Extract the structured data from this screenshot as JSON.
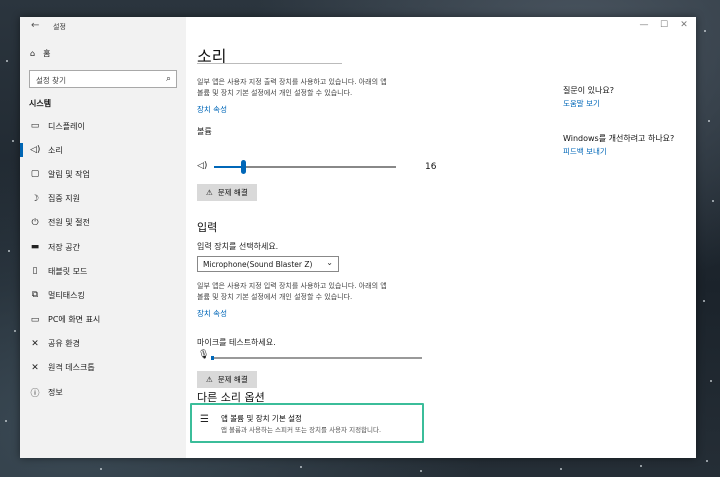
{
  "window": {
    "app_title": "설정",
    "controls": {
      "minimize": "—",
      "maximize": "☐",
      "close": "✕"
    }
  },
  "sidebar": {
    "home": "홈",
    "search_placeholder": "설정 찾기",
    "section": "시스템",
    "items": [
      {
        "label": "디스플레이",
        "icon": "monitor-icon"
      },
      {
        "label": "소리",
        "icon": "speaker-icon",
        "active": true
      },
      {
        "label": "알림 및 작업",
        "icon": "notification-icon"
      },
      {
        "label": "집중 지원",
        "icon": "moon-icon"
      },
      {
        "label": "전원 및 절전",
        "icon": "power-icon"
      },
      {
        "label": "저장 공간",
        "icon": "storage-icon"
      },
      {
        "label": "태블릿 모드",
        "icon": "tablet-icon"
      },
      {
        "label": "멀티태스킹",
        "icon": "multitask-icon"
      },
      {
        "label": "PC에 화면 표시",
        "icon": "project-icon"
      },
      {
        "label": "공유 환경",
        "icon": "share-icon"
      },
      {
        "label": "원격 데스크톱",
        "icon": "remote-icon"
      },
      {
        "label": "정보",
        "icon": "info-icon"
      }
    ]
  },
  "main": {
    "title": "소리",
    "output_desc_1": "일부 앱은 사용자 지정 출력 장치를 사용하고 있습니다. 아래의 앱",
    "output_desc_2": "볼륨 및 장치 기본 설정에서 개인 설정할 수 있습니다.",
    "output_props_link": "장치 속성",
    "volume_label": "볼륨",
    "volume_value": "16",
    "volume_percent": 16,
    "troubleshoot_label": "문제 해결",
    "input_heading": "입력",
    "input_select_label": "입력 장치를 선택하세요.",
    "input_device": "Microphone(Sound Blaster Z)",
    "input_desc_1": "일부 앱은 사용자 지정 입력 장치를 사용하고 있습니다. 아래의 앱",
    "input_desc_2": "볼륨 및 장치 기본 설정에서 개인 설정할 수 있습니다.",
    "input_props_link": "장치 속성",
    "mic_test_label": "마이크를 테스트하세요.",
    "mic_level": 0,
    "troubleshoot2_label": "문제 해결",
    "other_heading": "다른 소리 옵션",
    "app_volume_title": "앱 볼륨 및 장치 기본 설정",
    "app_volume_desc": "앱 볼륨과 사용하는 스피커 또는 장치를 사용자 지정합니다."
  },
  "right": {
    "question": "질문이 있나요?",
    "help_link": "도움말 보기",
    "improve": "Windows를 개선하려고 하나요?",
    "feedback_link": "피드백 보내기"
  },
  "colors": {
    "accent": "#0067b8",
    "highlight_border": "#3bbd9a"
  }
}
